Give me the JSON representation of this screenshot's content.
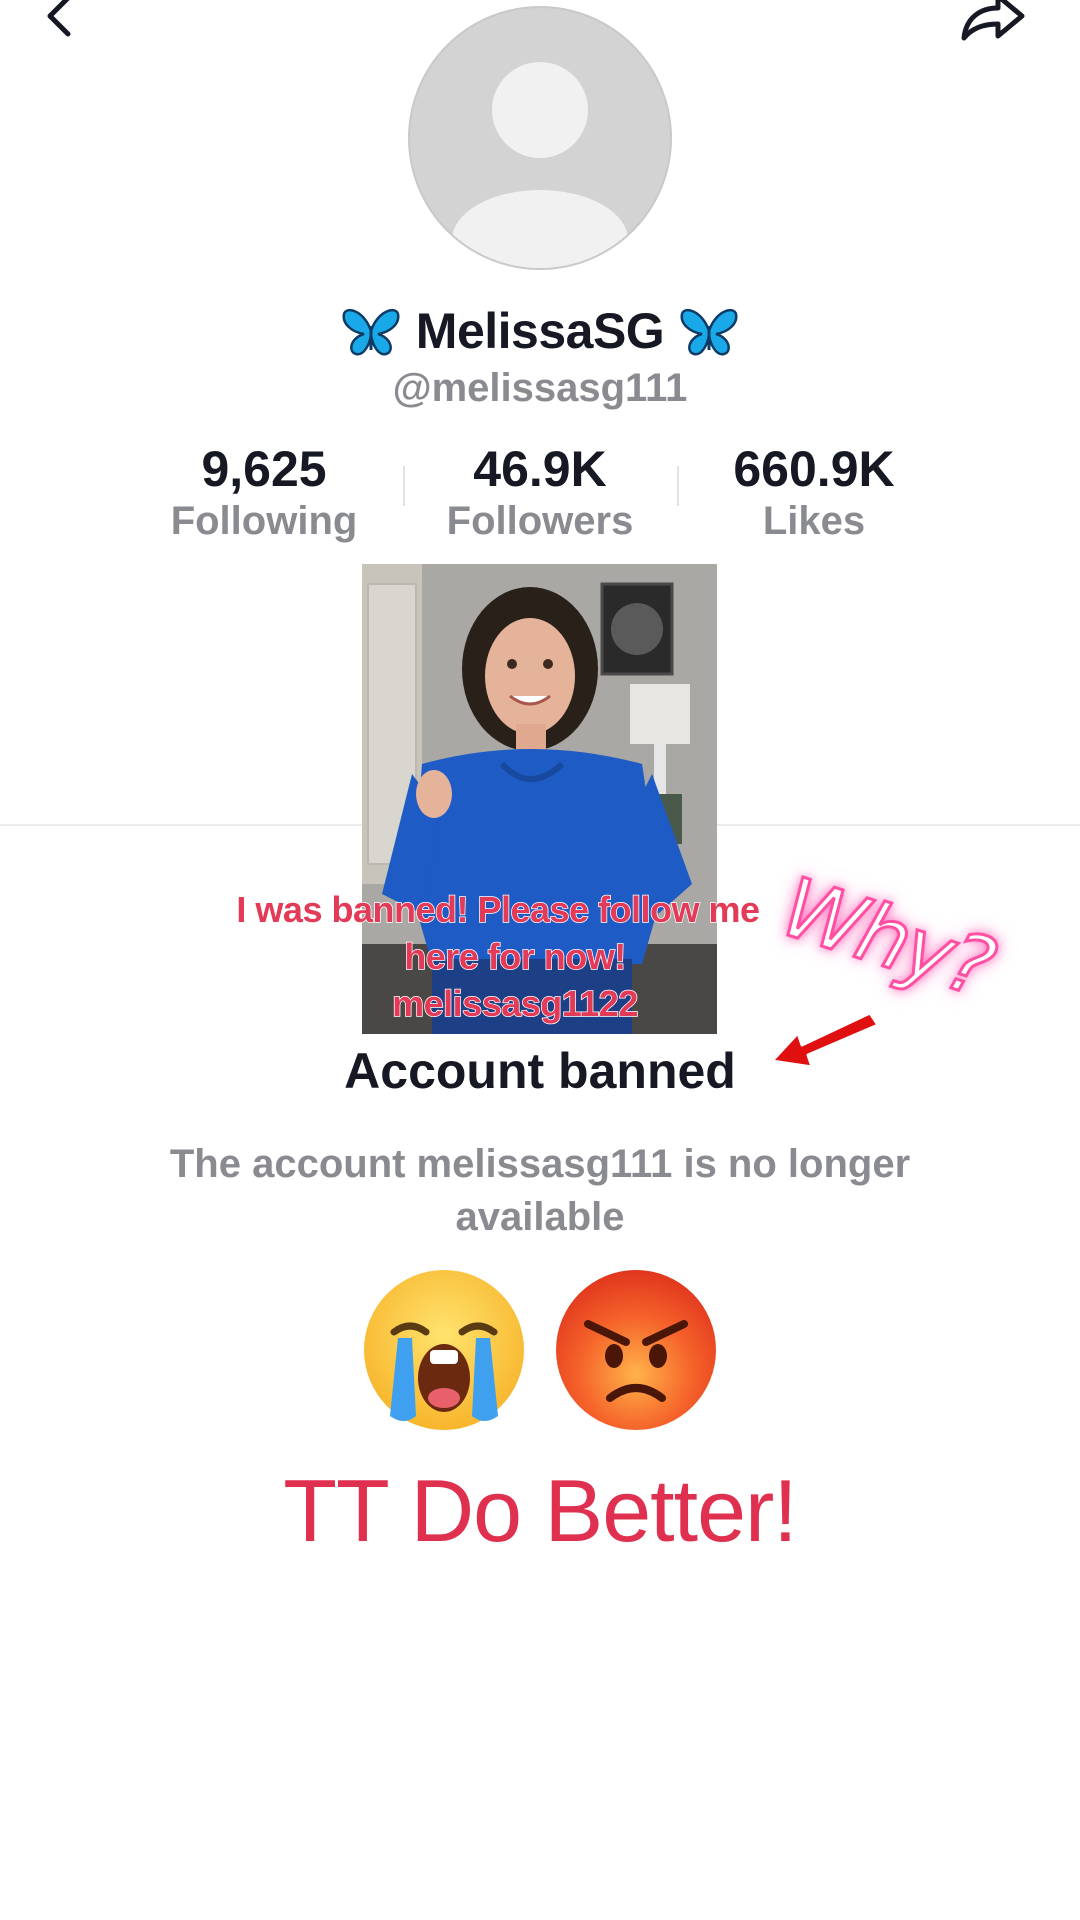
{
  "profile": {
    "display_name": "MelissaSG",
    "handle": "@melissasg111"
  },
  "stats": {
    "following_count": "9,625",
    "following_label": "Following",
    "followers_count": "46.9K",
    "followers_label": "Followers",
    "likes_count": "660.9K",
    "likes_label": "Likes"
  },
  "overlay": {
    "line1": "I was banned! Please follow me",
    "line2": "here for now!",
    "line3": "melissasg1122",
    "why": "Why?"
  },
  "banned": {
    "title": "Account banned",
    "description": "The account melissasg111 is no longer available"
  },
  "caption": "TT Do Better!",
  "icons": {
    "back": "chevron-left-icon",
    "share": "share-arrow-icon",
    "butterfly": "butterfly-emoji",
    "emoji1": "loudly-crying-face-emoji",
    "emoji2": "angry-face-emoji"
  },
  "colors": {
    "overlay_text": "#e23a57",
    "caption_text": "#e0304f",
    "why_glow": "#ff4fa3",
    "muted_text": "#8a8b91",
    "primary_text": "#161823",
    "butterfly": "#1aa9e8"
  }
}
